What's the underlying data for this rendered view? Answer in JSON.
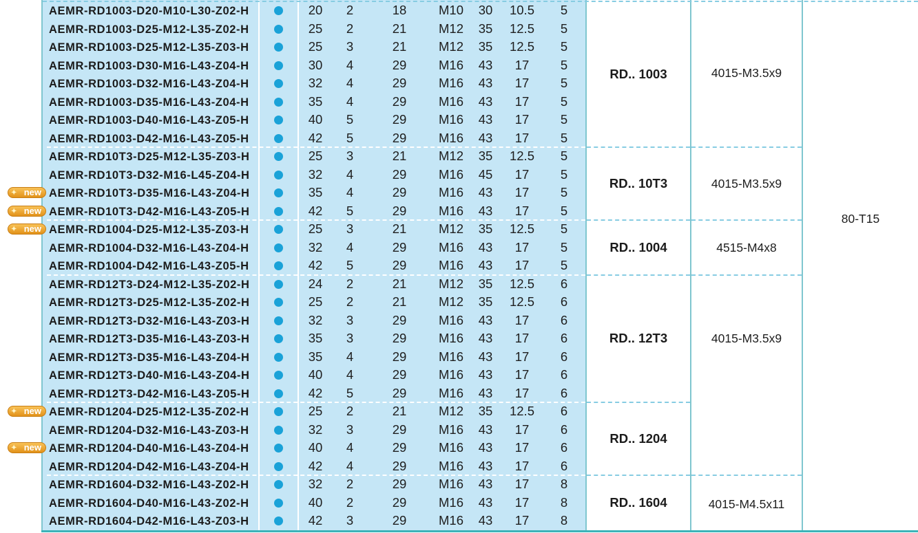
{
  "table": {
    "rows": [
      {
        "code": "AEMR-RD1003-D20-M10-L30-Z02-H",
        "d": "20",
        "z": "2",
        "d1": "18",
        "thread": "M10",
        "l": "30",
        "h": "10.5",
        "t": "5",
        "is_new": false
      },
      {
        "code": "AEMR-RD1003-D25-M12-L35-Z02-H",
        "d": "25",
        "z": "2",
        "d1": "21",
        "thread": "M12",
        "l": "35",
        "h": "12.5",
        "t": "5",
        "is_new": false
      },
      {
        "code": "AEMR-RD1003-D25-M12-L35-Z03-H",
        "d": "25",
        "z": "3",
        "d1": "21",
        "thread": "M12",
        "l": "35",
        "h": "12.5",
        "t": "5",
        "is_new": false
      },
      {
        "code": "AEMR-RD1003-D30-M16-L43-Z04-H",
        "d": "30",
        "z": "4",
        "d1": "29",
        "thread": "M16",
        "l": "43",
        "h": "17",
        "t": "5",
        "is_new": false
      },
      {
        "code": "AEMR-RD1003-D32-M16-L43-Z04-H",
        "d": "32",
        "z": "4",
        "d1": "29",
        "thread": "M16",
        "l": "43",
        "h": "17",
        "t": "5",
        "is_new": false
      },
      {
        "code": "AEMR-RD1003-D35-M16-L43-Z04-H",
        "d": "35",
        "z": "4",
        "d1": "29",
        "thread": "M16",
        "l": "43",
        "h": "17",
        "t": "5",
        "is_new": false
      },
      {
        "code": "AEMR-RD1003-D40-M16-L43-Z05-H",
        "d": "40",
        "z": "5",
        "d1": "29",
        "thread": "M16",
        "l": "43",
        "h": "17",
        "t": "5",
        "is_new": false
      },
      {
        "code": "AEMR-RD1003-D42-M16-L43-Z05-H",
        "d": "42",
        "z": "5",
        "d1": "29",
        "thread": "M16",
        "l": "43",
        "h": "17",
        "t": "5",
        "is_new": false
      },
      {
        "code": "AEMR-RD10T3-D25-M12-L35-Z03-H",
        "d": "25",
        "z": "3",
        "d1": "21",
        "thread": "M12",
        "l": "35",
        "h": "12.5",
        "t": "5",
        "is_new": false
      },
      {
        "code": "AEMR-RD10T3-D32-M16-L45-Z04-H",
        "d": "32",
        "z": "4",
        "d1": "29",
        "thread": "M16",
        "l": "45",
        "h": "17",
        "t": "5",
        "is_new": false
      },
      {
        "code": "AEMR-RD10T3-D35-M16-L43-Z04-H",
        "d": "35",
        "z": "4",
        "d1": "29",
        "thread": "M16",
        "l": "43",
        "h": "17",
        "t": "5",
        "is_new": true
      },
      {
        "code": "AEMR-RD10T3-D42-M16-L43-Z05-H",
        "d": "42",
        "z": "5",
        "d1": "29",
        "thread": "M16",
        "l": "43",
        "h": "17",
        "t": "5",
        "is_new": true
      },
      {
        "code": "AEMR-RD1004-D25-M12-L35-Z03-H",
        "d": "25",
        "z": "3",
        "d1": "21",
        "thread": "M12",
        "l": "35",
        "h": "12.5",
        "t": "5",
        "is_new": true
      },
      {
        "code": "AEMR-RD1004-D32-M16-L43-Z04-H",
        "d": "32",
        "z": "4",
        "d1": "29",
        "thread": "M16",
        "l": "43",
        "h": "17",
        "t": "5",
        "is_new": false
      },
      {
        "code": "AEMR-RD1004-D42-M16-L43-Z05-H",
        "d": "42",
        "z": "5",
        "d1": "29",
        "thread": "M16",
        "l": "43",
        "h": "17",
        "t": "5",
        "is_new": false
      },
      {
        "code": "AEMR-RD12T3-D24-M12-L35-Z02-H",
        "d": "24",
        "z": "2",
        "d1": "21",
        "thread": "M12",
        "l": "35",
        "h": "12.5",
        "t": "6",
        "is_new": false
      },
      {
        "code": "AEMR-RD12T3-D25-M12-L35-Z02-H",
        "d": "25",
        "z": "2",
        "d1": "21",
        "thread": "M12",
        "l": "35",
        "h": "12.5",
        "t": "6",
        "is_new": false
      },
      {
        "code": "AEMR-RD12T3-D32-M16-L43-Z03-H",
        "d": "32",
        "z": "3",
        "d1": "29",
        "thread": "M16",
        "l": "43",
        "h": "17",
        "t": "6",
        "is_new": false
      },
      {
        "code": "AEMR-RD12T3-D35-M16-L43-Z03-H",
        "d": "35",
        "z": "3",
        "d1": "29",
        "thread": "M16",
        "l": "43",
        "h": "17",
        "t": "6",
        "is_new": false
      },
      {
        "code": "AEMR-RD12T3-D35-M16-L43-Z04-H",
        "d": "35",
        "z": "4",
        "d1": "29",
        "thread": "M16",
        "l": "43",
        "h": "17",
        "t": "6",
        "is_new": false
      },
      {
        "code": "AEMR-RD12T3-D40-M16-L43-Z04-H",
        "d": "40",
        "z": "4",
        "d1": "29",
        "thread": "M16",
        "l": "43",
        "h": "17",
        "t": "6",
        "is_new": false
      },
      {
        "code": "AEMR-RD12T3-D42-M16-L43-Z05-H",
        "d": "42",
        "z": "5",
        "d1": "29",
        "thread": "M16",
        "l": "43",
        "h": "17",
        "t": "6",
        "is_new": false
      },
      {
        "code": "AEMR-RD1204-D25-M12-L35-Z02-H",
        "d": "25",
        "z": "2",
        "d1": "21",
        "thread": "M12",
        "l": "35",
        "h": "12.5",
        "t": "6",
        "is_new": true
      },
      {
        "code": "AEMR-RD1204-D32-M16-L43-Z03-H",
        "d": "32",
        "z": "3",
        "d1": "29",
        "thread": "M16",
        "l": "43",
        "h": "17",
        "t": "6",
        "is_new": false
      },
      {
        "code": "AEMR-RD1204-D40-M16-L43-Z04-H",
        "d": "40",
        "z": "4",
        "d1": "29",
        "thread": "M16",
        "l": "43",
        "h": "17",
        "t": "6",
        "is_new": true
      },
      {
        "code": "AEMR-RD1204-D42-M16-L43-Z04-H",
        "d": "42",
        "z": "4",
        "d1": "29",
        "thread": "M16",
        "l": "43",
        "h": "17",
        "t": "6",
        "is_new": false
      },
      {
        "code": "AEMR-RD1604-D32-M16-L43-Z02-H",
        "d": "32",
        "z": "2",
        "d1": "29",
        "thread": "M16",
        "l": "43",
        "h": "17",
        "t": "8",
        "is_new": false
      },
      {
        "code": "AEMR-RD1604-D40-M16-L43-Z02-H",
        "d": "40",
        "z": "2",
        "d1": "29",
        "thread": "M16",
        "l": "43",
        "h": "17",
        "t": "8",
        "is_new": false
      },
      {
        "code": "AEMR-RD1604-D42-M16-L43-Z03-H",
        "d": "42",
        "z": "3",
        "d1": "29",
        "thread": "M16",
        "l": "43",
        "h": "17",
        "t": "8",
        "is_new": false
      }
    ],
    "insert_groups": [
      {
        "label": "RD.. 1003",
        "first_row": 0,
        "count": 8
      },
      {
        "label": "RD.. 10T3",
        "first_row": 8,
        "count": 4
      },
      {
        "label": "RD.. 1004",
        "first_row": 12,
        "count": 3
      },
      {
        "label": "RD.. 12T3",
        "first_row": 15,
        "count": 7
      },
      {
        "label": "RD.. 1204",
        "first_row": 22,
        "count": 4
      },
      {
        "label": "RD.. 1604",
        "first_row": 26,
        "count": 3
      }
    ],
    "screw_groups": [
      {
        "label": "4015-M3.5x9",
        "first_row": 0,
        "count": 8
      },
      {
        "label": "4015-M3.5x9",
        "first_row": 8,
        "count": 4
      },
      {
        "label": "4515-M4x8",
        "first_row": 12,
        "count": 3
      },
      {
        "label": "4015-M3.5x9",
        "first_row": 15,
        "count": 11
      },
      {
        "label": "4015-M4.5x11",
        "first_row": 26,
        "count": 3
      }
    ],
    "key_group": {
      "label": "80-T15",
      "first_row": 0,
      "count": 29
    },
    "new_badge_label": "new",
    "stock_dot_icon": "filled-circle-icon",
    "colors": {
      "stripe": "#c5e6f6",
      "dot": "#1aa2d8",
      "badge": "#f0a830",
      "divider": "#7fc6cf",
      "dashed": "#86cce2"
    }
  }
}
